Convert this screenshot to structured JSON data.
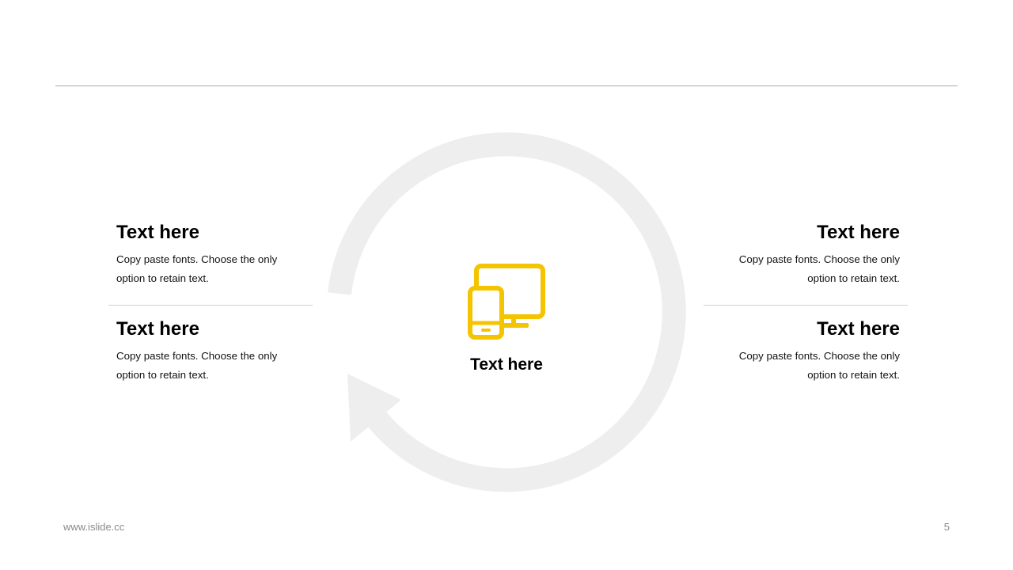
{
  "blocks": {
    "top_left": {
      "title": "Text here",
      "line1": "Copy paste fonts. Choose the only",
      "line2": "option to retain text."
    },
    "bottom_left": {
      "title": "Text here",
      "line1": "Copy paste fonts. Choose the only",
      "line2": "option to retain text."
    },
    "top_right": {
      "title": "Text here",
      "line1": "Copy paste fonts. Choose the only",
      "line2": "option to retain text."
    },
    "bottom_right": {
      "title": "Text here",
      "line1": "Copy paste fonts. Choose the only",
      "line2": "option to retain text."
    }
  },
  "center": {
    "label": "Text here",
    "icon": "devices-icon"
  },
  "footer": {
    "url": "www.islide.cc",
    "page_number": "5"
  },
  "colors": {
    "accent": "#F5C400",
    "cycle": "#EEEEEE",
    "rule": "#A8A8A8"
  }
}
